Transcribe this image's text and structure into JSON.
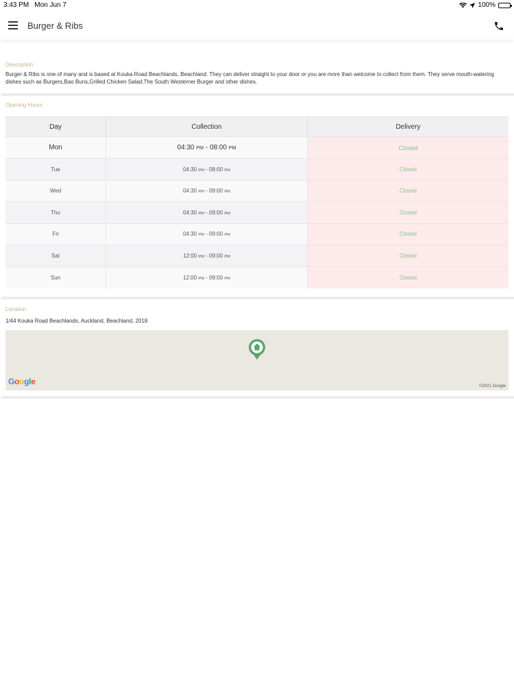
{
  "status_bar": {
    "time": "3:43 PM",
    "date": "Mon Jun 7",
    "battery": "100%"
  },
  "header": {
    "title": "Burger & Ribs",
    "menu_icon": "hamburger-menu-icon",
    "phone_icon": "phone-icon"
  },
  "description": {
    "label": "Description",
    "text": "Burger & Ribs is one of many and is based at Kouka Road Beachlands, Beachland. They can deliver straight to your door or you are more than welcome to collect from them. They serve mouth-watering dishes such as Burgers,Bao Buns,Grilled Chicken Salad,The South Westerner Burger and other dishes."
  },
  "hours": {
    "label": "Opening Hours",
    "columns": [
      "Day",
      "Collection",
      "Delivery"
    ],
    "rows": [
      {
        "day": "Mon",
        "open": "04:30",
        "open_ampm": "PM",
        "close": "08:00",
        "close_ampm": "PM",
        "delivery": "Closed"
      },
      {
        "day": "Tue",
        "open": "04:30",
        "open_ampm": "PM",
        "close": "08:00",
        "close_ampm": "PM",
        "delivery": "Closed"
      },
      {
        "day": "Wed",
        "open": "04:30",
        "open_ampm": "PM",
        "close": "09:00",
        "close_ampm": "PM",
        "delivery": "Closed"
      },
      {
        "day": "Thu",
        "open": "04:30",
        "open_ampm": "PM",
        "close": "09:00",
        "close_ampm": "PM",
        "delivery": "Closed"
      },
      {
        "day": "Fri",
        "open": "04:30",
        "open_ampm": "PM",
        "close": "09:00",
        "close_ampm": "PM",
        "delivery": "Closed"
      },
      {
        "day": "Sat",
        "open": "12:00",
        "open_ampm": "PM",
        "close": "09:00",
        "close_ampm": "PM",
        "delivery": "Closed"
      },
      {
        "day": "Sun",
        "open": "12:00",
        "open_ampm": "PM",
        "close": "09:00",
        "close_ampm": "PM",
        "delivery": "Closed"
      }
    ]
  },
  "location": {
    "label": "Location",
    "address": "1/44 Kouka Road Beachlands, Auckland, Beachland, 2018",
    "map_logo": "Google",
    "map_copyright": "©2021 Google",
    "pin_icon": "home-map-pin-icon"
  },
  "colors": {
    "label_gold": "#c8b287",
    "closed_green": "#8bbf8b",
    "closed_bg": "#fdeaea",
    "pin_green": "#5aa56e",
    "map_bg": "#ebe8e1"
  }
}
